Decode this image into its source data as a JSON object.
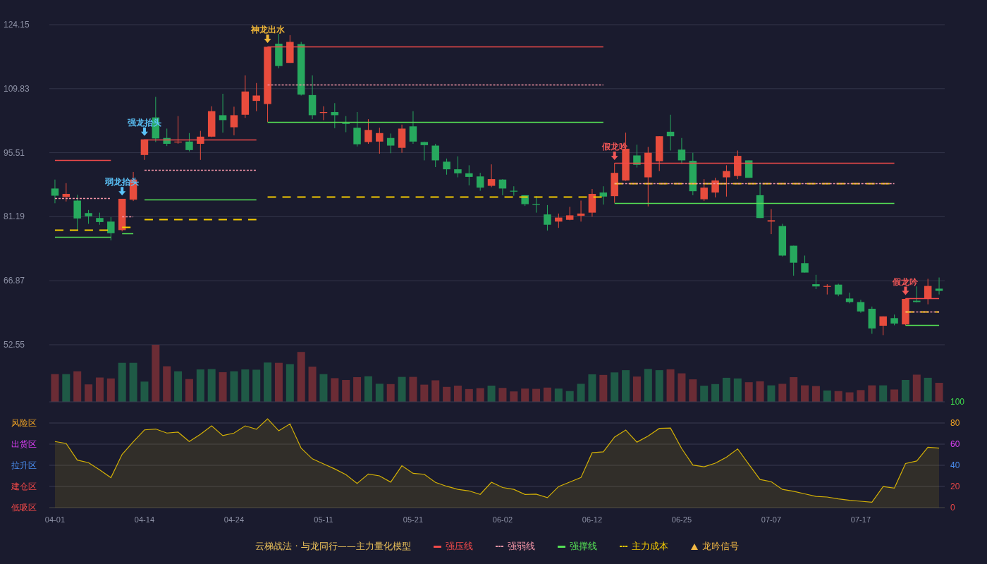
{
  "price_chart": {
    "chart_data": {
      "type": "candlestick",
      "ylim": [
        52.55,
        124.15
      ],
      "yticks": [
        {
          "value": 124.15,
          "label": "124.15"
        },
        {
          "value": 109.83,
          "label": "109.83"
        },
        {
          "value": 95.51,
          "label": "95.51"
        },
        {
          "value": 81.19,
          "label": "81.19"
        },
        {
          "value": 66.87,
          "label": "66.87"
        },
        {
          "value": 52.55,
          "label": "52.55"
        }
      ],
      "categories": [
        null,
        null,
        null,
        null,
        null,
        null,
        null,
        null,
        null,
        null,
        null,
        null,
        null,
        null,
        null,
        null,
        null,
        null,
        null,
        null,
        null,
        null,
        null,
        null,
        null,
        null,
        null,
        null,
        null,
        null,
        null,
        null,
        null,
        null,
        null,
        null,
        null,
        null,
        null,
        null,
        null,
        null,
        null,
        null,
        null,
        null,
        null,
        null,
        null,
        null,
        null,
        null,
        null,
        null,
        null,
        null,
        null,
        null,
        null,
        null,
        null,
        null,
        null,
        null,
        null,
        null,
        null,
        null,
        null,
        null,
        null,
        null,
        null,
        null,
        null,
        null,
        null,
        null,
        null,
        null
      ],
      "ohlc": [
        [
          87.5,
          89.5,
          84.2,
          85.9
        ],
        [
          85.6,
          88.7,
          84.6,
          86.3
        ],
        [
          84.8,
          86.1,
          78.1,
          80.8
        ],
        [
          82.0,
          82.7,
          79.6,
          81.3
        ],
        [
          80.9,
          82.1,
          79.4,
          80.0
        ],
        [
          80.1,
          81.1,
          75.9,
          77.5
        ],
        [
          78.2,
          85.2,
          77.9,
          85.2
        ],
        [
          85.0,
          91.2,
          84.7,
          89.5
        ],
        [
          95.0,
          98.5,
          93.9,
          98.5
        ],
        [
          103.4,
          108.0,
          97.9,
          98.7
        ],
        [
          98.8,
          100.9,
          97.0,
          97.5
        ],
        [
          97.8,
          103.7,
          97.5,
          98.0
        ],
        [
          98.0,
          99.9,
          95.8,
          96.1
        ],
        [
          97.5,
          100.4,
          93.9,
          99.1
        ],
        [
          99.1,
          105.9,
          99.0,
          104.8
        ],
        [
          103.9,
          108.7,
          100.0,
          102.8
        ],
        [
          101.2,
          105.8,
          99.4,
          103.9
        ],
        [
          104.0,
          112.8,
          103.3,
          109.2
        ],
        [
          107.1,
          111.1,
          104.8,
          108.3
        ],
        [
          106.4,
          119.2,
          102.4,
          119.2
        ],
        [
          119.9,
          122.1,
          114.4,
          114.9
        ],
        [
          115.6,
          121.8,
          115.6,
          120.3
        ],
        [
          119.8,
          120.3,
          108.3,
          108.5
        ],
        [
          108.4,
          112.8,
          103.0,
          103.9
        ],
        [
          104.4,
          105.9,
          102.8,
          104.6
        ],
        [
          104.6,
          106.6,
          101.0,
          103.9
        ],
        [
          102.1,
          103.7,
          100.1,
          102.0
        ],
        [
          101.1,
          104.6,
          96.9,
          97.4
        ],
        [
          97.9,
          103.0,
          97.5,
          100.6
        ],
        [
          98.0,
          101.1,
          95.3,
          99.9
        ],
        [
          98.8,
          99.8,
          95.4,
          97.1
        ],
        [
          96.6,
          101.8,
          95.5,
          100.9
        ],
        [
          101.4,
          104.8,
          97.5,
          98.0
        ],
        [
          97.9,
          98.0,
          93.8,
          97.2
        ],
        [
          97.1,
          97.5,
          92.3,
          93.8
        ],
        [
          93.5,
          94.2,
          90.6,
          91.8
        ],
        [
          91.8,
          94.7,
          90.0,
          90.9
        ],
        [
          90.9,
          92.7,
          88.2,
          90.1
        ],
        [
          90.2,
          91.0,
          87.0,
          87.7
        ],
        [
          88.1,
          92.9,
          87.8,
          89.6
        ],
        [
          89.5,
          89.6,
          86.0,
          87.5
        ],
        [
          87.0,
          88.0,
          85.9,
          86.9
        ],
        [
          86.0,
          86.0,
          83.6,
          84.0
        ],
        [
          84.0,
          85.8,
          82.1,
          83.9
        ],
        [
          81.7,
          83.8,
          78.1,
          79.4
        ],
        [
          80.1,
          81.9,
          78.7,
          81.0
        ],
        [
          80.5,
          83.4,
          80.4,
          81.5
        ],
        [
          81.4,
          84.8,
          80.1,
          81.9
        ],
        [
          82.1,
          87.4,
          81.2,
          86.3
        ],
        [
          86.6,
          88.0,
          83.9,
          85.7
        ],
        [
          85.8,
          93.2,
          84.3,
          91.0
        ],
        [
          89.3,
          100.0,
          89.2,
          96.4
        ],
        [
          94.9,
          97.3,
          92.2,
          92.8
        ],
        [
          90.0,
          96.8,
          83.5,
          95.5
        ],
        [
          93.6,
          99.2,
          91.4,
          99.2
        ],
        [
          100.2,
          104.0,
          96.0,
          99.2
        ],
        [
          96.2,
          98.8,
          93.0,
          93.8
        ],
        [
          93.7,
          95.5,
          86.0,
          86.9
        ],
        [
          85.1,
          89.6,
          84.7,
          87.7
        ],
        [
          86.6,
          89.9,
          85.5,
          89.3
        ],
        [
          90.0,
          92.7,
          85.7,
          91.4
        ],
        [
          90.3,
          96.0,
          89.6,
          94.8
        ],
        [
          93.8,
          93.8,
          89.9,
          89.9
        ],
        [
          86.0,
          88.9,
          80.9,
          80.9
        ],
        [
          80.1,
          82.9,
          77.3,
          80.4
        ],
        [
          79.1,
          79.6,
          72.3,
          72.5
        ],
        [
          74.7,
          74.7,
          68.0,
          70.9
        ],
        [
          70.8,
          72.5,
          68.7,
          68.7
        ],
        [
          66.1,
          68.2,
          65.0,
          65.6
        ],
        [
          65.5,
          66.1,
          63.8,
          65.7
        ],
        [
          66.0,
          66.2,
          63.4,
          63.8
        ],
        [
          62.9,
          64.2,
          61.8,
          62.1
        ],
        [
          62.1,
          62.6,
          59.7,
          60.0
        ],
        [
          60.6,
          61.1,
          55.0,
          56.2
        ],
        [
          56.8,
          58.9,
          54.7,
          58.9
        ],
        [
          58.5,
          59.3,
          56.9,
          57.3
        ],
        [
          57.1,
          62.9,
          56.9,
          62.8
        ],
        [
          62.4,
          65.6,
          62.0,
          62.1
        ],
        [
          62.8,
          67.3,
          61.6,
          65.7
        ],
        [
          65.1,
          67.6,
          63.8,
          64.6
        ]
      ],
      "series": [
        {
          "name": "强压线",
          "type": "line",
          "line_style": "solid",
          "color": "#f04a4a",
          "values": [
            93.9,
            93.9,
            93.9,
            93.9,
            93.9,
            93.9,
            null,
            null,
            98.5,
            98.5,
            98.5,
            98.5,
            98.5,
            98.5,
            98.5,
            98.5,
            98.5,
            98.5,
            98.5,
            119.2,
            119.2,
            119.2,
            119.2,
            119.2,
            119.2,
            119.2,
            119.2,
            119.2,
            119.2,
            119.2,
            119.2,
            119.2,
            119.2,
            119.2,
            119.2,
            119.2,
            119.2,
            119.2,
            119.2,
            119.2,
            119.2,
            119.2,
            119.2,
            119.2,
            119.2,
            119.2,
            119.2,
            119.2,
            119.2,
            119.2,
            93.2,
            93.2,
            93.2,
            93.2,
            93.2,
            93.2,
            93.2,
            93.2,
            93.2,
            93.2,
            93.2,
            93.2,
            93.2,
            93.2,
            93.2,
            93.2,
            93.2,
            93.2,
            93.2,
            93.2,
            93.2,
            93.2,
            93.2,
            93.2,
            93.2,
            93.2,
            62.9,
            62.9,
            62.9,
            62.9
          ]
        },
        {
          "name": "强弱线",
          "type": "line",
          "line_style": "dotted",
          "color": "#f596a8",
          "values": [
            85.3,
            85.3,
            85.3,
            85.3,
            85.3,
            85.3,
            81.3,
            81.3,
            91.7,
            91.7,
            91.7,
            91.7,
            91.7,
            91.7,
            91.7,
            91.7,
            91.7,
            91.7,
            91.7,
            110.8,
            110.8,
            110.8,
            110.8,
            110.8,
            110.8,
            110.8,
            110.8,
            110.8,
            110.8,
            110.8,
            110.8,
            110.8,
            110.8,
            110.8,
            110.8,
            110.8,
            110.8,
            110.8,
            110.8,
            110.8,
            110.8,
            110.8,
            110.8,
            110.8,
            110.8,
            110.8,
            110.8,
            110.8,
            110.8,
            110.8,
            88.7,
            88.7,
            88.7,
            88.7,
            88.7,
            88.7,
            88.7,
            88.7,
            88.7,
            88.7,
            88.7,
            88.7,
            88.7,
            88.7,
            88.7,
            88.7,
            88.7,
            88.7,
            88.7,
            88.7,
            88.7,
            88.7,
            88.7,
            88.7,
            88.7,
            88.7,
            59.9,
            59.9,
            59.9,
            59.9
          ]
        },
        {
          "name": "强撑线",
          "type": "line",
          "line_style": "solid",
          "color": "#55e055",
          "values": [
            76.7,
            76.7,
            76.7,
            76.7,
            76.7,
            76.7,
            77.4,
            77.4,
            85.0,
            85.0,
            85.0,
            85.0,
            85.0,
            85.0,
            85.0,
            85.0,
            85.0,
            85.0,
            85.0,
            102.4,
            102.4,
            102.4,
            102.4,
            102.4,
            102.4,
            102.4,
            102.4,
            102.4,
            102.4,
            102.4,
            102.4,
            102.4,
            102.4,
            102.4,
            102.4,
            102.4,
            102.4,
            102.4,
            102.4,
            102.4,
            102.4,
            102.4,
            102.4,
            102.4,
            102.4,
            102.4,
            102.4,
            102.4,
            102.4,
            102.4,
            84.3,
            84.3,
            84.3,
            84.3,
            84.3,
            84.3,
            84.3,
            84.3,
            84.3,
            84.3,
            84.3,
            84.3,
            84.3,
            84.3,
            84.3,
            84.3,
            84.3,
            84.3,
            84.3,
            84.3,
            84.3,
            84.3,
            84.3,
            84.3,
            84.3,
            84.3,
            56.9,
            56.9,
            56.9,
            56.9
          ]
        },
        {
          "name": "主力成本",
          "type": "line",
          "line_style": "dashed",
          "color": "#f5cc00",
          "values": [
            78.3,
            78.3,
            78.3,
            78.3,
            78.3,
            78.3,
            78.9,
            78.9,
            80.7,
            80.7,
            80.7,
            80.7,
            80.7,
            80.7,
            80.7,
            80.7,
            80.7,
            80.7,
            80.7,
            85.6,
            85.6,
            85.6,
            85.6,
            85.6,
            85.6,
            85.6,
            85.6,
            85.6,
            85.6,
            85.6,
            85.6,
            85.6,
            85.6,
            85.6,
            85.6,
            85.6,
            85.6,
            85.6,
            85.6,
            85.6,
            85.6,
            85.6,
            85.6,
            85.6,
            85.6,
            85.6,
            85.6,
            85.6,
            85.6,
            85.6,
            88.7,
            88.7,
            88.7,
            88.7,
            88.7,
            88.7,
            88.7,
            88.7,
            88.7,
            88.7,
            88.7,
            88.7,
            88.7,
            88.7,
            88.7,
            88.7,
            88.7,
            88.7,
            88.7,
            88.7,
            88.7,
            88.7,
            88.7,
            88.7,
            88.7,
            88.7,
            59.9,
            59.9,
            59.9,
            59.9
          ]
        },
        {
          "name": "弱龙抬头",
          "type": "scatter",
          "color": "#5bc2f7",
          "values": [
            null,
            null,
            null,
            null,
            null,
            null,
            86.9,
            null,
            null,
            null,
            null,
            null,
            null,
            null,
            null,
            null,
            null,
            null,
            null,
            null,
            null,
            null,
            null,
            null,
            null,
            null,
            null,
            null,
            null,
            null,
            null,
            null,
            null,
            null,
            null,
            null,
            null,
            null,
            null,
            null,
            null,
            null,
            null,
            null,
            null,
            null,
            null,
            null,
            null,
            null,
            null,
            null,
            null,
            null,
            null,
            null,
            null,
            null,
            null,
            null,
            null,
            null,
            null,
            null,
            null,
            null,
            null,
            null,
            null,
            null,
            null,
            null,
            null,
            null,
            null,
            null,
            null,
            null,
            null,
            null
          ]
        },
        {
          "name": "强龙抬头",
          "type": "scatter",
          "color": "#5bc2f7",
          "values": [
            null,
            null,
            null,
            null,
            null,
            null,
            null,
            null,
            100.2,
            null,
            null,
            null,
            null,
            null,
            null,
            null,
            null,
            null,
            null,
            null,
            null,
            null,
            null,
            null,
            null,
            null,
            null,
            null,
            null,
            null,
            null,
            null,
            null,
            null,
            null,
            null,
            null,
            null,
            null,
            null,
            null,
            null,
            null,
            null,
            null,
            null,
            null,
            null,
            null,
            null,
            null,
            null,
            null,
            null,
            null,
            null,
            null,
            null,
            null,
            null,
            null,
            null,
            null,
            null,
            null,
            null,
            null,
            null,
            null,
            null,
            null,
            null,
            null,
            null,
            null,
            null,
            null,
            null,
            null,
            null
          ]
        },
        {
          "name": "神龙出水",
          "type": "scatter",
          "color": "#f2b838",
          "values": [
            null,
            null,
            null,
            null,
            null,
            null,
            null,
            null,
            null,
            null,
            null,
            null,
            null,
            null,
            null,
            null,
            null,
            null,
            null,
            121.0,
            null,
            null,
            null,
            null,
            null,
            null,
            null,
            null,
            null,
            null,
            null,
            null,
            null,
            null,
            null,
            null,
            null,
            null,
            null,
            null,
            null,
            null,
            null,
            null,
            null,
            null,
            null,
            null,
            null,
            null,
            null,
            null,
            null,
            null,
            null,
            null,
            null,
            null,
            null,
            null,
            null,
            null,
            null,
            null,
            null,
            null,
            null,
            null,
            null,
            null,
            null,
            null,
            null,
            null,
            null,
            null,
            null,
            null,
            null,
            null
          ]
        },
        {
          "name": "假龙吟",
          "type": "scatter",
          "color": "#f25757",
          "values": [
            null,
            null,
            null,
            null,
            null,
            null,
            null,
            null,
            null,
            null,
            null,
            null,
            null,
            null,
            null,
            null,
            null,
            null,
            null,
            null,
            null,
            null,
            null,
            null,
            null,
            null,
            null,
            null,
            null,
            null,
            null,
            null,
            null,
            null,
            null,
            null,
            null,
            null,
            null,
            null,
            null,
            null,
            null,
            null,
            null,
            null,
            null,
            null,
            null,
            null,
            94.8,
            null,
            null,
            null,
            null,
            null,
            null,
            null,
            null,
            null,
            null,
            null,
            null,
            null,
            null,
            null,
            null,
            null,
            null,
            null,
            null,
            null,
            null,
            null,
            null,
            null,
            null,
            null,
            null,
            null
          ]
        },
        {
          "name": "假龙吟",
          "type": "scatter",
          "color": "#f25757",
          "values": [
            null,
            null,
            null,
            null,
            null,
            null,
            null,
            null,
            null,
            null,
            null,
            null,
            null,
            null,
            null,
            null,
            null,
            null,
            null,
            null,
            null,
            null,
            null,
            null,
            null,
            null,
            null,
            null,
            null,
            null,
            null,
            null,
            null,
            null,
            null,
            null,
            null,
            null,
            null,
            null,
            null,
            null,
            null,
            null,
            null,
            null,
            null,
            null,
            null,
            null,
            null,
            null,
            null,
            null,
            null,
            null,
            null,
            null,
            null,
            null,
            null,
            null,
            null,
            null,
            null,
            null,
            null,
            null,
            null,
            null,
            null,
            null,
            null,
            null,
            null,
            null,
            64.6,
            null,
            null,
            null
          ]
        }
      ]
    }
  },
  "indicator_chart": {
    "zones": [
      {
        "label": "风险区",
        "color": "#f5a623"
      },
      {
        "label": "出货区",
        "color": "#e040fb"
      },
      {
        "label": "拉升区",
        "color": "#4a8ef0"
      },
      {
        "label": "建仓区",
        "color": "#f04848"
      },
      {
        "label": "低吸区",
        "color": "#f04848"
      }
    ],
    "chart_data": {
      "type": "area",
      "ylim": [
        0,
        100
      ],
      "yticks": [
        {
          "value": 100,
          "label": "100"
        },
        {
          "value": 80,
          "label": "80"
        },
        {
          "value": 60,
          "label": "60"
        },
        {
          "value": 40,
          "label": "40"
        },
        {
          "value": 20,
          "label": "20"
        },
        {
          "value": 0,
          "label": "0"
        }
      ],
      "categories": [
        "04-01",
        null,
        null,
        null,
        null,
        null,
        null,
        null,
        "04-14",
        null,
        null,
        null,
        null,
        null,
        null,
        null,
        "04-24",
        null,
        null,
        null,
        null,
        null,
        null,
        null,
        "05-11",
        null,
        null,
        null,
        null,
        null,
        null,
        null,
        "05-21",
        null,
        null,
        null,
        null,
        null,
        null,
        null,
        "06-02",
        null,
        null,
        null,
        null,
        null,
        null,
        null,
        "06-12",
        null,
        null,
        null,
        null,
        null,
        null,
        null,
        "06-25",
        null,
        null,
        null,
        null,
        null,
        null,
        null,
        "07-07",
        null,
        null,
        null,
        null,
        null,
        null,
        null,
        "07-17",
        null,
        null,
        null,
        null,
        null,
        null,
        null
      ],
      "values": [
        62.5,
        60.7,
        44.9,
        42.5,
        35.7,
        28.3,
        50.3,
        62.2,
        73.5,
        74.3,
        70.5,
        71.4,
        62.5,
        69.3,
        77.3,
        68.1,
        70.5,
        77.3,
        74.1,
        83.9,
        72.6,
        79.1,
        56.2,
        46.1,
        41.3,
        36.6,
        31.2,
        22.9,
        31.8,
        30.0,
        24.1,
        39.6,
        32.4,
        31.5,
        23.8,
        20.2,
        17.2,
        15.8,
        12.5,
        24.0,
        19.0,
        17.2,
        12.4,
        12.7,
        9.4,
        19.9,
        24.2,
        28.4,
        51.9,
        52.8,
        66.7,
        73.4,
        61.9,
        67.6,
        74.9,
        75.2,
        55.8,
        40.2,
        38.6,
        42.0,
        47.7,
        55.5,
        40.9,
        26.6,
        24.5,
        17.2,
        15.4,
        13.0,
        10.6,
        10.0,
        8.2,
        6.9,
        6.0,
        5.1,
        19.9,
        18.4,
        41.7,
        44.1,
        57.1,
        56.2
      ]
    }
  },
  "legend": {
    "title": "云梯战法 · 与龙同行——主力量化模型",
    "signal": {
      "label": "龙吟信号",
      "color": "#f2b844"
    }
  }
}
